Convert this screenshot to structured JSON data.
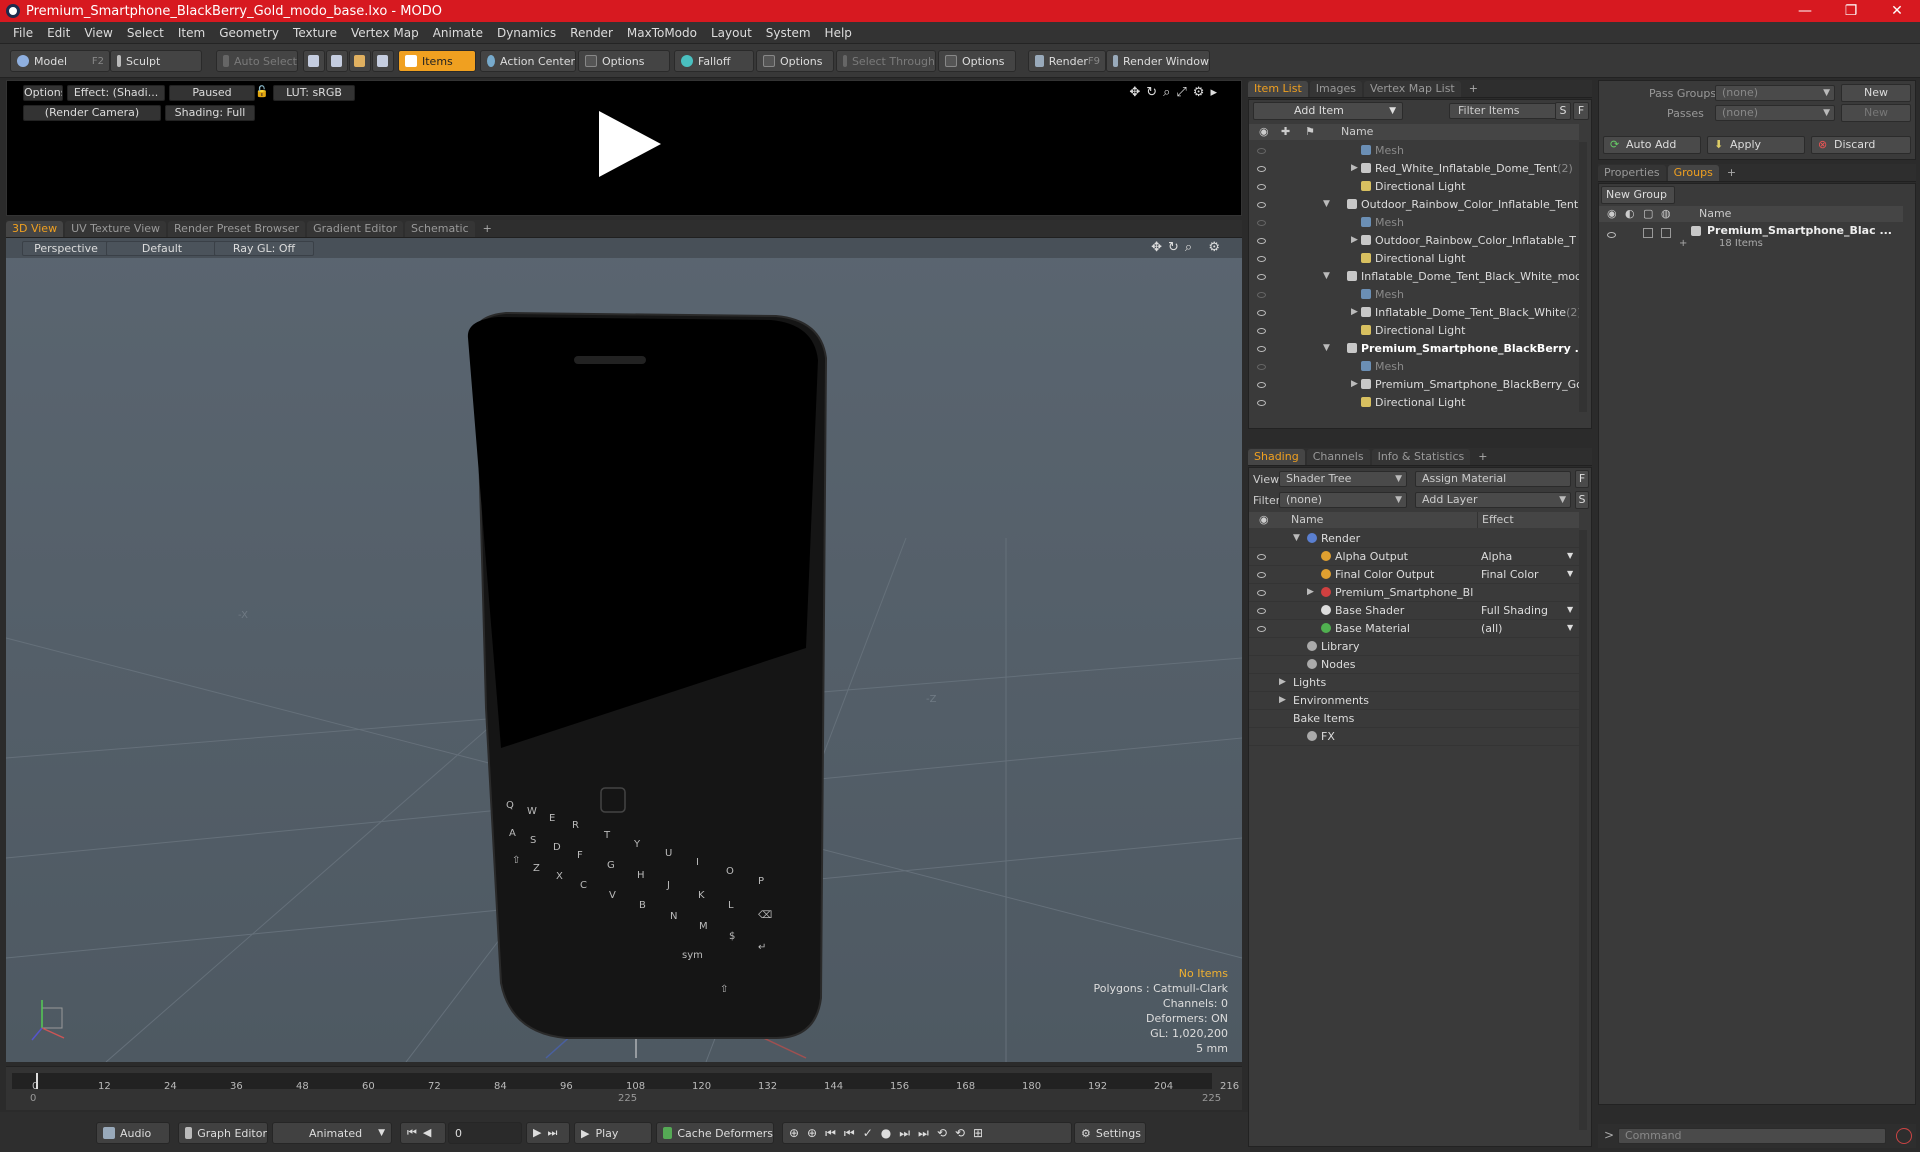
{
  "window": {
    "title": "Premium_Smartphone_BlackBerry_Gold_modo_base.lxo - MODO",
    "minimize": "—",
    "maximize": "❐",
    "close": "✕"
  },
  "menu": [
    "File",
    "Edit",
    "View",
    "Select",
    "Item",
    "Geometry",
    "Texture",
    "Vertex Map",
    "Animate",
    "Dynamics",
    "Render",
    "MaxToModo",
    "Layout",
    "System",
    "Help"
  ],
  "toolbar": {
    "model": "Model",
    "model_key": "F2",
    "sculpt": "Sculpt",
    "auto_select": "Auto Select",
    "items": "Items",
    "action_center": "Action Center",
    "options1": "Options",
    "falloff": "Falloff",
    "options2": "Options",
    "select_through": "Select Through",
    "options3": "Options",
    "render": "Render",
    "render_key": "F9",
    "render_window": "Render Window"
  },
  "preview": {
    "options": "Options",
    "effect": "Effect: (Shadi...",
    "paused": "Paused",
    "lut": "LUT: sRGB",
    "camera": "(Render Camera)",
    "shading": "Shading: Full"
  },
  "viewtabs": [
    "3D View",
    "UV Texture View",
    "Render Preset Browser",
    "Gradient Editor",
    "Schematic",
    "+"
  ],
  "viewport": {
    "perspective": "Perspective",
    "default": "Default",
    "raygl": "Ray GL: Off",
    "axis_x": "-X",
    "axis_z": "-Z",
    "hud": {
      "no_items": "No Items",
      "polygons": "Polygons : Catmull-Clark",
      "channels": "Channels: 0",
      "deformers": "Deformers: ON",
      "gl": "GL: 1,020,200",
      "scale": "5 mm"
    }
  },
  "phone": {
    "keys_row1": [
      "Q",
      "W",
      "E",
      "R",
      "T",
      "Y",
      "U",
      "I",
      "O",
      "P"
    ],
    "keys_row2": [
      "A",
      "S",
      "D",
      "F",
      "G",
      "H",
      "J",
      "K",
      "L",
      "⌫"
    ],
    "keys_row3": [
      "⇧",
      "Z",
      "X",
      "C",
      "V",
      "B",
      "N",
      "M",
      "$",
      "↵"
    ],
    "keys_row4": [
      "sym",
      "⇧"
    ]
  },
  "timeline": {
    "ticks": [
      "0",
      "12",
      "24",
      "36",
      "48",
      "60",
      "72",
      "84",
      "96",
      "108",
      "120",
      "132",
      "144",
      "156",
      "168",
      "180",
      "192",
      "204",
      "216"
    ],
    "start": "0",
    "mid": "225",
    "end": "225"
  },
  "bottombar": {
    "audio": "Audio",
    "graph_editor": "Graph Editor",
    "animated": "Animated",
    "frame": "0",
    "play": "Play",
    "cache_deformers": "Cache Deformers",
    "settings": "Settings"
  },
  "itemlist": {
    "tabs": [
      "Item List",
      "Images",
      "Vertex Map List",
      "+"
    ],
    "add_item": "Add Item",
    "filter_items": "Filter Items",
    "s": "S",
    "f": "F",
    "col_name": "Name",
    "rows": [
      {
        "label": "Mesh",
        "kind": "mesh",
        "indent": 2,
        "dim": true
      },
      {
        "label": "Red_White_Inflatable_Dome_Tent",
        "count": "(2)",
        "kind": "group",
        "indent": 2,
        "tri": "▶"
      },
      {
        "label": "Directional Light",
        "kind": "light",
        "indent": 2
      },
      {
        "label": "Outdoor_Rainbow_Color_Inflatable_Tent...",
        "kind": "group",
        "indent": 1,
        "tri": "▼"
      },
      {
        "label": "Mesh",
        "kind": "mesh",
        "indent": 2,
        "dim": true
      },
      {
        "label": "Outdoor_Rainbow_Color_Inflatable_T ...",
        "kind": "group",
        "indent": 2,
        "tri": "▶"
      },
      {
        "label": "Directional Light",
        "kind": "light",
        "indent": 2
      },
      {
        "label": "Inflatable_Dome_Tent_Black_White_mod ...",
        "kind": "group",
        "indent": 1,
        "tri": "▼"
      },
      {
        "label": "Mesh",
        "kind": "mesh",
        "indent": 2,
        "dim": true
      },
      {
        "label": "Inflatable_Dome_Tent_Black_White",
        "count": "(2)",
        "kind": "group",
        "indent": 2,
        "tri": "▶"
      },
      {
        "label": "Directional Light",
        "kind": "light",
        "indent": 2
      },
      {
        "label": "Premium_Smartphone_BlackBerry ...",
        "kind": "group",
        "indent": 1,
        "tri": "▼",
        "bold": true
      },
      {
        "label": "Mesh",
        "kind": "mesh",
        "indent": 2,
        "dim": true
      },
      {
        "label": "Premium_Smartphone_BlackBerry_Gol ...",
        "kind": "group",
        "indent": 2,
        "tri": "▶"
      },
      {
        "label": "Directional Light",
        "kind": "light",
        "indent": 2
      }
    ]
  },
  "shading": {
    "tabs": [
      "Shading",
      "Channels",
      "Info & Statistics",
      "+"
    ],
    "view_label": "View",
    "view_value": "Shader Tree",
    "assign_material": "Assign Material",
    "f": "F",
    "filter_label": "Filter",
    "filter_value": "(none)",
    "add_layer": "Add Layer",
    "s": "S",
    "col_name": "Name",
    "col_effect": "Effect",
    "rows": [
      {
        "label": "Render",
        "effect": "",
        "indent": 1,
        "tri": "▼",
        "icon": "#5a7fd0",
        "eye": false
      },
      {
        "label": "Alpha Output",
        "effect": "Alpha",
        "indent": 2,
        "icon": "#e0a030",
        "eye": true
      },
      {
        "label": "Final Color Output",
        "effect": "Final Color",
        "indent": 2,
        "icon": "#e0a030",
        "eye": true
      },
      {
        "label": "Premium_Smartphone_Blac ...",
        "effect": "",
        "indent": 2,
        "tri": "▶",
        "icon": "#d04040",
        "eye": true
      },
      {
        "label": "Base Shader",
        "effect": "Full Shading",
        "indent": 2,
        "icon": "#dddddd",
        "eye": true
      },
      {
        "label": "Base Material",
        "effect": "(all)",
        "indent": 2,
        "icon": "#50b050",
        "eye": true
      },
      {
        "label": "Library",
        "effect": "",
        "indent": 1,
        "icon": "#aaaaaa",
        "eye": false
      },
      {
        "label": "Nodes",
        "effect": "",
        "indent": 1,
        "icon": "#aaaaaa",
        "eye": false
      },
      {
        "label": "Lights",
        "effect": "",
        "indent": 0,
        "tri": "▶",
        "eye": false
      },
      {
        "label": "Environments",
        "effect": "",
        "indent": 0,
        "tri": "▶",
        "eye": false
      },
      {
        "label": "Bake Items",
        "effect": "",
        "indent": 0,
        "eye": false
      },
      {
        "label": "FX",
        "effect": "",
        "indent": 1,
        "icon": "#aaaaaa",
        "eye": false
      }
    ]
  },
  "groups": {
    "pass_groups": "Pass Groups",
    "pass_groups_value": "(none)",
    "new": "New",
    "passes": "Passes",
    "passes_value": "(none)",
    "new2": "New",
    "auto_add": "Auto Add",
    "apply": "Apply",
    "discard": "Discard",
    "tabs": [
      "Properties",
      "Groups",
      "+"
    ],
    "new_group": "New Group",
    "col_name": "Name",
    "item_name": "Premium_Smartphone_Blac ...",
    "item_count": "18 Items",
    "command": "Command"
  }
}
